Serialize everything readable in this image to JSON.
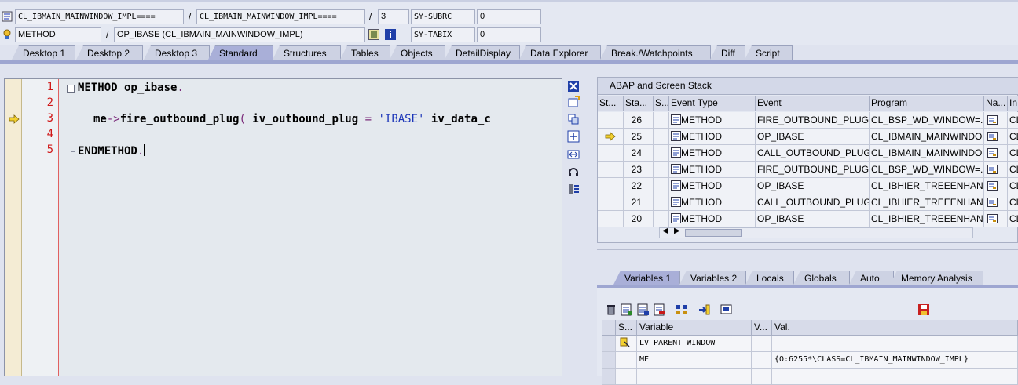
{
  "header": {
    "row1": {
      "program_field": "CL_IBMAIN_MAINWINDOW_IMPL====",
      "include_field": "CL_IBMAIN_MAINWINDOW_IMPL====",
      "line_field": "3",
      "sysvar_name": "SY-SUBRC",
      "sysvar_value": "0"
    },
    "row2": {
      "type_field": "METHOD",
      "event_field": "OP_IBASE (CL_IBMAIN_MAINWINDOW_IMPL)",
      "sysvar_name": "SY-TABIX",
      "sysvar_value": "0"
    },
    "separator": "/"
  },
  "tabs": [
    "Desktop 1",
    "Desktop 2",
    "Desktop 3",
    "Standard",
    "Structures",
    "Tables",
    "Objects",
    "DetailDisplay",
    "Data Explorer",
    "Break./Watchpoints",
    "Diff",
    "Script"
  ],
  "editor": {
    "line_numbers": [
      "1",
      "2",
      "3",
      "4",
      "5"
    ],
    "line1": {
      "kw": "METHOD",
      "rest": " op_ibase",
      "dot": "."
    },
    "line3": {
      "a": "me",
      "arrow": "->",
      "b": "fire_outbound_plug",
      "paren": "(",
      "c": " iv_outbound_plug ",
      "eq": "=",
      "str": "'IBASE'",
      "d": " iv_data_c"
    },
    "line5": {
      "kw": "ENDMETHOD",
      "dot": "."
    }
  },
  "stack": {
    "title": "ABAP and Screen Stack",
    "columns": [
      "St...",
      "Sta...",
      "S...",
      "Event Type",
      "Event",
      "Program",
      "Na...",
      "In"
    ],
    "rows": [
      {
        "level": "26",
        "event_type": "METHOD",
        "event": "FIRE_OUTBOUND_PLUG",
        "program": "CL_BSP_WD_WINDOW=...",
        "inc": "CL"
      },
      {
        "level": "25",
        "event_type": "METHOD",
        "event": "OP_IBASE",
        "program": "CL_IBMAIN_MAINWINDO...",
        "inc": "CL"
      },
      {
        "level": "24",
        "event_type": "METHOD",
        "event": "CALL_OUTBOUND_PLUG",
        "program": "CL_IBMAIN_MAINWINDO...",
        "inc": "CL"
      },
      {
        "level": "23",
        "event_type": "METHOD",
        "event": "FIRE_OUTBOUND_PLUG",
        "program": "CL_BSP_WD_WINDOW=...",
        "inc": "CL"
      },
      {
        "level": "22",
        "event_type": "METHOD",
        "event": "OP_IBASE",
        "program": "CL_IBHIER_TREEENHAN...",
        "inc": "CL"
      },
      {
        "level": "21",
        "event_type": "METHOD",
        "event": "CALL_OUTBOUND_PLUG",
        "program": "CL_IBHIER_TREEENHAN...",
        "inc": "CL"
      },
      {
        "level": "20",
        "event_type": "METHOD",
        "event": "OP_IBASE",
        "program": "CL_IBHIER_TREEENHAN...",
        "inc": "CL"
      }
    ]
  },
  "var_tabs": [
    "Variables 1",
    "Variables 2",
    "Locals",
    "Globals",
    "Auto",
    "Memory Analysis"
  ],
  "variables": {
    "columns": [
      "S...",
      "Variable",
      "V...",
      "Val."
    ],
    "rows": [
      {
        "name": "LV_PARENT_WINDOW",
        "value": ""
      },
      {
        "name": "ME",
        "value": "{O:6255*\\CLASS=CL_IBMAIN_MAINWINDOW_IMPL}"
      }
    ]
  },
  "colors": {
    "accent": "#a9afd8",
    "line_number": "#d01818",
    "string": "#1a34b8"
  }
}
